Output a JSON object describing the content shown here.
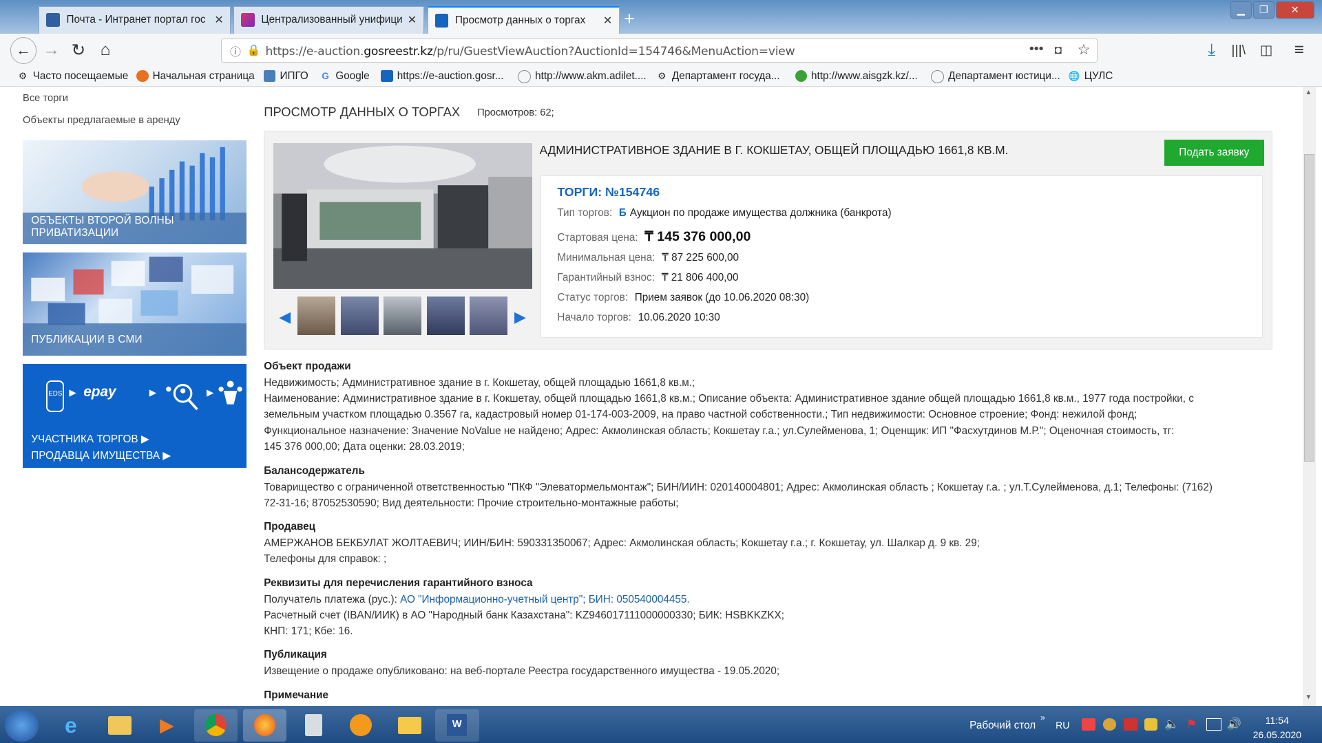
{
  "browser": {
    "tabs": [
      {
        "label": "Почта - Интранет портал гос",
        "active": false,
        "icon": "mail-icon"
      },
      {
        "label": "Централизованный унифици",
        "active": false,
        "icon": "pen-icon"
      },
      {
        "label": "Просмотр данных о торгах",
        "active": true,
        "icon": "site-icon"
      }
    ],
    "url": {
      "prefix": "https://e-auction.",
      "domain": "gosreestr.kz",
      "path": "/p/ru/GuestViewAuction?AuctionId=154746&MenuAction=view"
    },
    "bookmarks": [
      {
        "label": "Часто посещаемые",
        "icon": "gear-icon"
      },
      {
        "label": "Начальная страница",
        "icon": "firefox-icon"
      },
      {
        "label": "ИПГО",
        "icon": "page-icon"
      },
      {
        "label": "Google",
        "icon": "google-icon"
      },
      {
        "label": "https://e-auction.gosr...",
        "icon": "site-icon"
      },
      {
        "label": "http://www.akm.adilet....",
        "icon": "emblem-icon"
      },
      {
        "label": "Департамент госуда...",
        "icon": "gear-icon"
      },
      {
        "label": "http://www.aisgzk.kz/...",
        "icon": "globe-green-icon"
      },
      {
        "label": "Департамент юстици...",
        "icon": "emblem-icon"
      },
      {
        "label": "ЦУЛС",
        "icon": "globe-icon"
      }
    ]
  },
  "sidebar": {
    "links": [
      "Все торги",
      "Объекты предлагаемые в аренду"
    ],
    "banners": [
      {
        "caption": "ОБЪЕКТЫ ВТОРОЙ ВОЛНЫ ПРИВАТИЗАЦИИ"
      },
      {
        "caption": "ПУБЛИКАЦИИ В СМИ"
      }
    ],
    "epay": {
      "eds": "EDS",
      "epay": "epay",
      "line1": "УЧАСТНИКА ТОРГОВ ▶",
      "line2": "ПРОДАВЦА ИМУЩЕСТВА ▶"
    }
  },
  "main": {
    "heading": "ПРОСМОТР ДАННЫХ О ТОРГАХ",
    "views": "Просмотров: 62;",
    "lot_title": "АДМИНИСТРАТИВНОЕ ЗДАНИЕ В Г. КОКШЕТАУ, ОБЩЕЙ ПЛОЩАДЬЮ 1661,8 КВ.М.",
    "apply_button": "Подать заявку",
    "torgi": "ТОРГИ: №154746",
    "details": {
      "type_label": "Тип торгов:",
      "type_badge": "Б",
      "type_value": "Аукцион по продаже имущества должника (банкрота)",
      "start_label": "Стартовая цена:",
      "start_value": "₸ 145 376 000,00",
      "min_label": "Минимальная цена:",
      "min_value": "₸ 87 225 600,00",
      "guarantee_label": "Гарантийный взнос:",
      "guarantee_value": "₸ 21 806 400,00",
      "status_label": "Статус торгов:",
      "status_value": "Прием заявок (до 10.06.2020 08:30)",
      "begin_label": "Начало торгов:",
      "begin_value": "10.06.2020 10:30"
    },
    "sections": {
      "object_title": "Объект продажи",
      "object_l1": "Недвижимость; Административное здание в г. Кокшетау, общей площадью 1661,8 кв.м.;",
      "object_l2": "Наименование: Административное здание в г. Кокшетау, общей площадью 1661,8 кв.м.; Описание объекта: Административное здание общей площадью 1661,8 кв.м., 1977 года постройки, с",
      "object_l3": "земельным участком площадью 0.3567 га, кадастровый номер 01-174-003-2009, на право частной собственности.; Тип недвижимости: Основное строение; Фонд: нежилой фонд;",
      "object_l4": "Функциональное назначение: Значение NoValue не найдено; Адрес: Акмолинская область; Кокшетау г.а.; ул.Сулейменова, 1; Оценщик: ИП \"Фасхутдинов М.Р.\"; Оценочная стоимость, тг:",
      "object_l5": "145 376 000,00; Дата оценки: 28.03.2019;",
      "holder_title": "Балансодержатель",
      "holder_l1": "Товарищество с ограниченной ответственностью \"ПКФ \"Элеватормельмонтаж\"; БИН/ИИН: 020140004801; Адрес: Акмолинская область ; Кокшетау г.а. ; ул.Т.Сулейменова, д.1; Телефоны: (7162)",
      "holder_l2": "72-31-16; 87052530590; Вид деятельности: Прочие строительно-монтажные работы;",
      "seller_title": "Продавец",
      "seller_l1": "АМЕРЖАНОВ БЕКБУЛАТ ЖОЛТАЕВИЧ; ИИН/БИН: 590331350067;  Адрес: Акмолинская область; Кокшетау г.а.; г. Кокшетау, ул. Шалкар д. 9 кв. 29;",
      "seller_l2": "Телефоны для справок: ;",
      "req_title": "Реквизиты для перечисления гарантийного взноса",
      "req_l1_a": "Получатель платежа (рус.): ",
      "req_l1_b": "АО \"Информационно-учетный центр\"; БИН: 050540004455.",
      "req_l2": "Расчетный счет (IBAN/ИИК) в АО \"Народный банк Казахстана\": KZ946017111000000330; БИК: HSBKKZKX;",
      "req_l3": "КНП: 171; Кбе: 16.",
      "pub_title": "Публикация",
      "pub_l1": "Извещение о продаже опубликовано: на веб-портале Реестра государственного имущества - 19.05.2020;",
      "note_title": "Примечание"
    }
  },
  "taskbar": {
    "desktop": "Рабочий стол",
    "lang": "RU",
    "time": "11:54",
    "date": "26.05.2020"
  }
}
